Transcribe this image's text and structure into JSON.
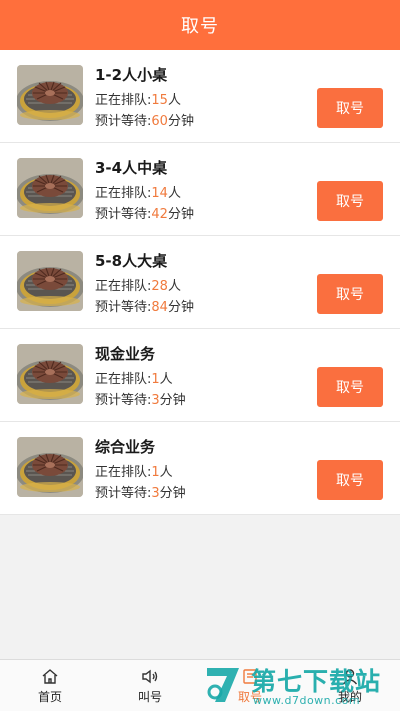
{
  "header": {
    "title": "取号"
  },
  "queue_items": [
    {
      "title": "1-2人小桌",
      "queue_label": "正在排队:",
      "queue_count": "15",
      "queue_unit": "人",
      "wait_label": "预计等待:",
      "wait_minutes": "60",
      "wait_unit": "分钟",
      "button": "取号"
    },
    {
      "title": "3-4人中桌",
      "queue_label": "正在排队:",
      "queue_count": "14",
      "queue_unit": "人",
      "wait_label": "预计等待:",
      "wait_minutes": "42",
      "wait_unit": "分钟",
      "button": "取号"
    },
    {
      "title": "5-8人大桌",
      "queue_label": "正在排队:",
      "queue_count": "28",
      "queue_unit": "人",
      "wait_label": "预计等待:",
      "wait_minutes": "84",
      "wait_unit": "分钟",
      "button": "取号"
    },
    {
      "title": "现金业务",
      "queue_label": "正在排队:",
      "queue_count": "1",
      "queue_unit": "人",
      "wait_label": "预计等待:",
      "wait_minutes": "3",
      "wait_unit": "分钟",
      "button": "取号"
    },
    {
      "title": "综合业务",
      "queue_label": "正在排队:",
      "queue_count": "1",
      "queue_unit": "人",
      "wait_label": "预计等待:",
      "wait_minutes": "3",
      "wait_unit": "分钟",
      "button": "取号"
    }
  ],
  "tabbar": {
    "items": [
      {
        "label": "首页",
        "icon": "home-icon"
      },
      {
        "label": "叫号",
        "icon": "speaker-icon"
      },
      {
        "label": "取号",
        "icon": "ticket-icon",
        "active": true
      },
      {
        "label": "我的",
        "icon": "user-icon"
      }
    ]
  },
  "watermark": {
    "title": "第七下载站",
    "url": "www.d7down.com"
  },
  "colors": {
    "header": "#ff6f3c",
    "button": "#fa6f3f",
    "accent_number": "#f07a3d",
    "watermark": "#18a9a8"
  }
}
